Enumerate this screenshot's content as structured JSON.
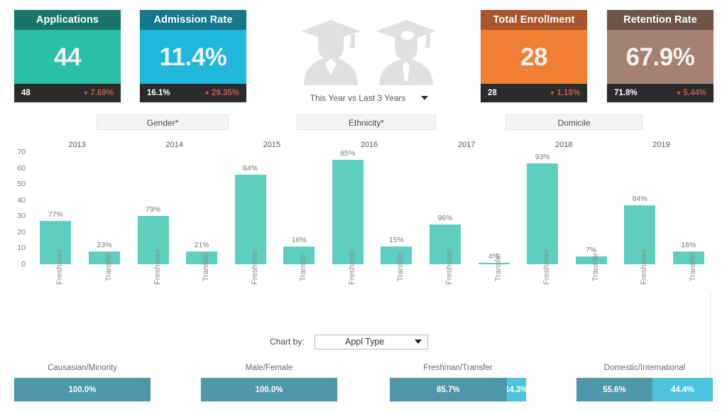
{
  "kpis": [
    {
      "title": "Applications",
      "value": "44",
      "prev": "48",
      "delta": "7.69%",
      "delta_dir": "down",
      "head_color": "#19746a",
      "body_color": "#2ac0a8",
      "foot_color": "#2b2b2b",
      "delta_color": "#c25a4c"
    },
    {
      "title": "Admission Rate",
      "value": "11.4%",
      "prev": "16.1%",
      "delta": "29.35%",
      "delta_dir": "down",
      "head_color": "#14788f",
      "body_color": "#21b7d9",
      "foot_color": "#2b2b2b",
      "delta_color": "#c25a4c"
    },
    {
      "title": "Total Enrollment",
      "value": "28",
      "prev": "28",
      "delta": "1.18%",
      "delta_dir": "down",
      "head_color": "#a8562a",
      "body_color": "#ef8033",
      "foot_color": "#2b2b2b",
      "delta_color": "#c25a4c"
    },
    {
      "title": "Retention Rate",
      "value": "67.9%",
      "prev": "71.8%",
      "delta": "5.44%",
      "delta_dir": "down",
      "head_color": "#6e5548",
      "body_color": "#a48172",
      "foot_color": "#2b2b2b",
      "delta_color": "#c25a4c"
    }
  ],
  "period_filter": {
    "label": "This Year vs Last 3 Years",
    "caret": "chevron-down-icon"
  },
  "grad_icons": {
    "female": "female-graduate-icon",
    "male": "male-graduate-icon",
    "color": "#e0e0e0"
  },
  "tabs": [
    {
      "label": "Gender*"
    },
    {
      "label": "Ethnicity*"
    },
    {
      "label": "Domicile"
    }
  ],
  "chart_by": {
    "label": "Chart by:",
    "value": "Appl Type"
  },
  "chart_data": {
    "type": "bar",
    "title": "",
    "xlabel": "",
    "ylabel": "",
    "ylim": [
      0,
      70
    ],
    "yticks": [
      0,
      10,
      20,
      30,
      40,
      50,
      60,
      70
    ],
    "grid": false,
    "legend": "none",
    "bar_color": "#5ecfbd",
    "group_labels": [
      "2013",
      "2014",
      "2015",
      "2016",
      "2017",
      "2018",
      "2019"
    ],
    "categories": [
      "Freshman",
      "Transfer"
    ],
    "bars": [
      {
        "group": "2013",
        "category": "Freshman",
        "value": 27,
        "label": "77%"
      },
      {
        "group": "2013",
        "category": "Transfer",
        "value": 8,
        "label": "23%"
      },
      {
        "group": "2014",
        "category": "Freshman",
        "value": 30,
        "label": "79%"
      },
      {
        "group": "2014",
        "category": "Transfer",
        "value": 8,
        "label": "21%"
      },
      {
        "group": "2015",
        "category": "Freshman",
        "value": 56,
        "label": "84%"
      },
      {
        "group": "2015",
        "category": "Transfer",
        "value": 11,
        "label": "16%"
      },
      {
        "group": "2016",
        "category": "Freshman",
        "value": 65,
        "label": "85%"
      },
      {
        "group": "2016",
        "category": "Transfer",
        "value": 11,
        "label": "15%"
      },
      {
        "group": "2017",
        "category": "Freshman",
        "value": 25,
        "label": "96%"
      },
      {
        "group": "2017",
        "category": "Transfer",
        "value": 1,
        "label": "4%"
      },
      {
        "group": "2018",
        "category": "Freshman",
        "value": 63,
        "label": "93%"
      },
      {
        "group": "2018",
        "category": "Transfer",
        "value": 5,
        "label": "7%"
      },
      {
        "group": "2019",
        "category": "Freshman",
        "value": 37,
        "label": "84%"
      },
      {
        "group": "2019",
        "category": "Transfer",
        "value": 8,
        "label": "16%"
      }
    ]
  },
  "stacked_bars": [
    {
      "title": "Causasian/Minority",
      "segments": [
        {
          "label": "100.0%",
          "pct": 100.0,
          "color": "#4e97a8"
        }
      ]
    },
    {
      "title": "Male/Female",
      "segments": [
        {
          "label": "100.0%",
          "pct": 100.0,
          "color": "#4e97a8"
        }
      ]
    },
    {
      "title": "Freshman/Transfer",
      "segments": [
        {
          "label": "85.7%",
          "pct": 85.7,
          "color": "#4e97a8"
        },
        {
          "label": "14.3%",
          "pct": 14.3,
          "color": "#4ec3e0"
        }
      ]
    },
    {
      "title": "Domestic/International",
      "segments": [
        {
          "label": "55.6%",
          "pct": 55.6,
          "color": "#4e97a8"
        },
        {
          "label": "44.4%",
          "pct": 44.4,
          "color": "#4ec3e0"
        }
      ]
    }
  ]
}
